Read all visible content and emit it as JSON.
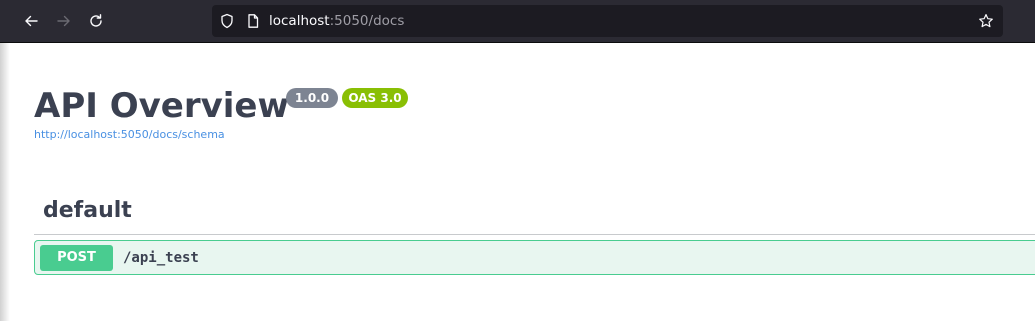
{
  "browser": {
    "url_host": "localhost",
    "url_rest": ":5050/docs"
  },
  "doc": {
    "title": "API Overview",
    "version_badge": "1.0.0",
    "oas_badge": "OAS 3.0",
    "schema_link": "http://localhost:5050/docs/schema"
  },
  "tags": [
    {
      "name": "default",
      "operations": [
        {
          "method": "POST",
          "path": "/api_test"
        }
      ]
    }
  ],
  "colors": {
    "post": "#49cc90",
    "post_bg": "#e8f6f0",
    "version_badge": "#7d8492",
    "oas_badge": "#89bf04",
    "link": "#4990e2",
    "heading": "#3b4151"
  }
}
